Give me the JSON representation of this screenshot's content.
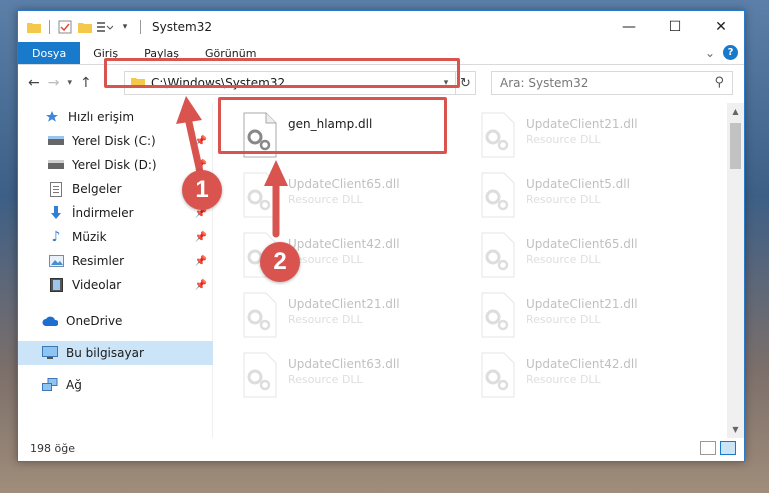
{
  "window": {
    "title": "System32",
    "controls": {
      "minimize": "—",
      "maximize": "☐",
      "close": "✕"
    }
  },
  "ribbon": {
    "tabs": [
      "Dosya",
      "Giriş",
      "Paylaş",
      "Görünüm"
    ],
    "help": "?",
    "expand": "⌄"
  },
  "address": {
    "path": "C:\\Windows\\System32",
    "search_placeholder": "Ara: System32"
  },
  "nav_pane": {
    "items": [
      {
        "label": "Hızlı erişim",
        "icon": "star-icon",
        "pinned": false
      },
      {
        "label": "Yerel Disk (C:)",
        "icon": "drive-icon",
        "pinned": true
      },
      {
        "label": "Yerel Disk (D:)",
        "icon": "drive-icon",
        "pinned": true
      },
      {
        "label": "Belgeler",
        "icon": "document-icon",
        "pinned": true
      },
      {
        "label": "İndirmeler",
        "icon": "download-icon",
        "pinned": true
      },
      {
        "label": "Müzik",
        "icon": "music-icon",
        "pinned": true
      },
      {
        "label": "Resimler",
        "icon": "pictures-icon",
        "pinned": true
      },
      {
        "label": "Videolar",
        "icon": "video-icon",
        "pinned": true
      },
      {
        "label": "OneDrive",
        "icon": "cloud-icon",
        "pinned": false
      },
      {
        "label": "Bu bilgisayar",
        "icon": "computer-icon",
        "pinned": false,
        "selected": true
      },
      {
        "label": "Ağ",
        "icon": "network-icon",
        "pinned": false
      }
    ]
  },
  "files": [
    {
      "name": "gen_hlamp.dll",
      "type": "",
      "highlighted": true
    },
    {
      "name": "UpdateClient21.dll",
      "type": "Resource DLL"
    },
    {
      "name": "UpdateClient65.dll",
      "type": "Resource DLL"
    },
    {
      "name": "UpdateClient5.dll",
      "type": "Resource DLL"
    },
    {
      "name": "UpdateClient42.dll",
      "type": "Resource DLL"
    },
    {
      "name": "UpdateClient65.dll",
      "type": "Resource DLL"
    },
    {
      "name": "UpdateClient21.dll",
      "type": "Resource DLL"
    },
    {
      "name": "UpdateClient21.dll",
      "type": "Resource DLL"
    },
    {
      "name": "UpdateClient63.dll",
      "type": "Resource DLL"
    },
    {
      "name": "UpdateClient42.dll",
      "type": "Resource DLL"
    }
  ],
  "status": {
    "item_count": "198 öğe"
  },
  "annotations": {
    "marker1": "1",
    "marker2": "2",
    "accent_color": "#d9534f"
  }
}
